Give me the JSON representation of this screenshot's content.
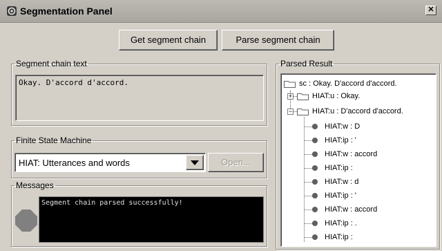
{
  "window": {
    "title": "Segmentation Panel",
    "close_glyph": "✕"
  },
  "toolbar": {
    "get_label": "Get segment chain",
    "parse_label": "Parse segment chain"
  },
  "segment_chain": {
    "legend": "Segment chain text",
    "text": "Okay. D'accord d'accord."
  },
  "fsm": {
    "legend": "Finite State Machine",
    "selected": "HIAT: Utterances and words",
    "open_label": "Open..."
  },
  "messages": {
    "legend": "Messages",
    "text": "Segment chain parsed successfully!"
  },
  "parsed": {
    "legend": "Parsed Result",
    "root": "sc : Okay. D'accord d'accord.",
    "u1": "HIAT:u : Okay.",
    "u2": "HIAT:u : D'accord d'accord.",
    "children": [
      "HIAT:w : D",
      "HIAT:ip : '",
      "HIAT:w : accord",
      "HIAT:ip :",
      "HIAT:w : d",
      "HIAT:ip : '",
      "HIAT:w : accord",
      "HIAT:ip : .",
      "HIAT:ip :"
    ]
  },
  "icons": {
    "app": "segmentation-app-icon",
    "close": "close-icon",
    "dropdown": "dropdown-arrow-icon",
    "status": "status-light-icon",
    "folder": "folder-icon",
    "node": "leaf-node-icon"
  },
  "colors": {
    "window_bg": "#d4d0c8",
    "messages_bg": "#000000",
    "messages_text": "#e0e0e0",
    "status_light": "#808080"
  }
}
